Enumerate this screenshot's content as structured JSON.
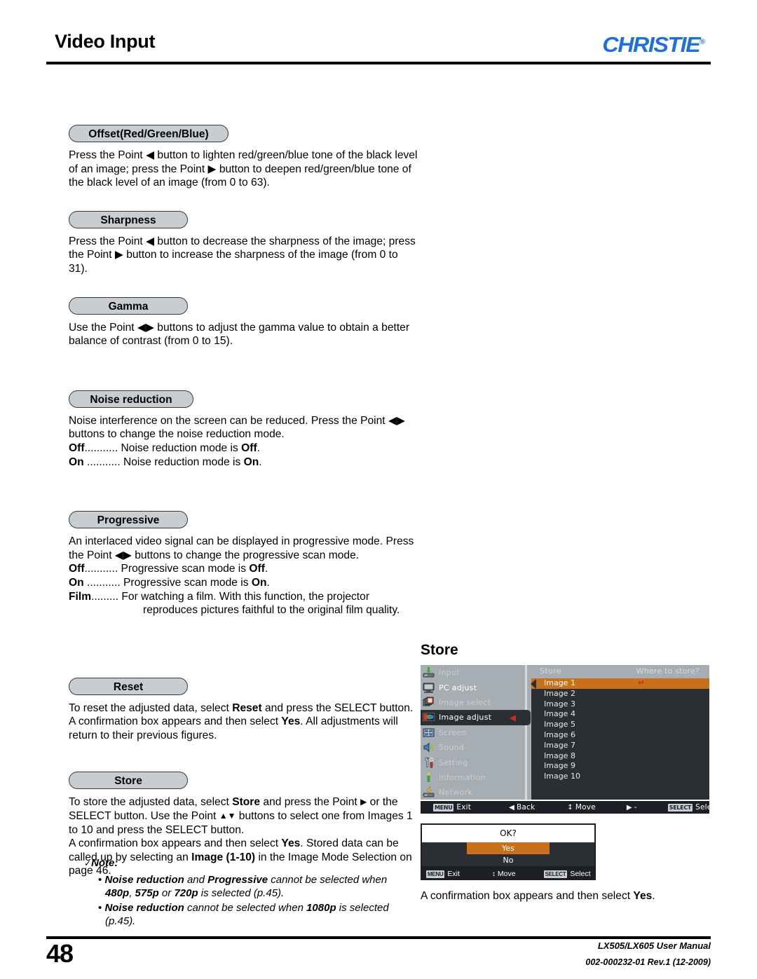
{
  "header": {
    "title": "Video Input",
    "logo_text": "CHRISTIE",
    "logo_color": "#1f6fe0",
    "registered_mark": "®"
  },
  "sections": [
    {
      "pill": "Offset(Red/Green/Blue)",
      "paragraphs": [
        "Press the Point ◀ button to lighten red/green/blue tone of the black level of an image; press the Point ▶ button to deepen red/green/blue tone of the black level of an image (from 0 to 63)."
      ],
      "definitions": []
    },
    {
      "pill": "Sharpness",
      "paragraphs": [
        "Press the Point ◀ button to decrease the sharpness of the image; press the Point ▶ button to increase the sharpness of the image (from 0 to 31)."
      ],
      "definitions": []
    },
    {
      "pill": "Gamma",
      "paragraphs": [
        "Use the Point ◀▶ buttons to adjust the gamma value to obtain a better balance of contrast (from 0 to 15)."
      ],
      "definitions": []
    },
    {
      "pill": "Noise reduction",
      "paragraphs": [
        "Noise interference on the screen can be reduced. Press the Point ◀▶ buttons to change the noise reduction mode."
      ],
      "definitions": [
        {
          "term": "Off",
          "dots": "...........",
          "desc_pre": "Noise reduction mode is ",
          "desc_bold": "Off",
          "desc_post": "."
        },
        {
          "term": "On",
          "dots": " ...........",
          "desc_pre": "Noise reduction mode is ",
          "desc_bold": "On",
          "desc_post": "."
        }
      ]
    },
    {
      "pill": "Progressive",
      "paragraphs": [
        "An interlaced video signal can be displayed in progressive mode. Press the Point ◀▶ buttons to change the progressive scan mode."
      ],
      "definitions": [
        {
          "term": "Off",
          "dots": "...........",
          "desc_pre": "Progressive scan mode is ",
          "desc_bold": "Off",
          "desc_post": "."
        },
        {
          "term": "On",
          "dots": " ...........",
          "desc_pre": "Progressive scan mode is ",
          "desc_bold": "On",
          "desc_post": "."
        },
        {
          "term": "Film",
          "dots": ".........",
          "desc_pre": "For watching a film. With this function, the projector",
          "desc_bold": "",
          "desc_post": "",
          "continuation": "reproduces pictures faithful to the original film quality."
        }
      ]
    },
    {
      "pill": "Reset",
      "paragraphs": [
        "To reset the adjusted data, select Reset and press the SELECT button. A confirmation box appears and then select Yes. All adjustments will return to their previous figures."
      ],
      "definitions": []
    },
    {
      "pill": "Store",
      "paragraphs": [
        "To store the adjusted data, select Store and press the Point ▶ or the SELECT button. Use the Point ▲▼ buttons to select one from Images 1 to 10 and press the SELECT button.",
        "A confirmation box appears and then select Yes. Stored data can be called up by selecting an Image (1-10) in the Image Mode Selection on page 46."
      ],
      "definitions": []
    }
  ],
  "note": {
    "check_glyph": "✓",
    "title": "Note:",
    "items": [
      "• Noise reduction and Progressive cannot be selected when 480p, 575p or 720p is selected (p.45).",
      "• Noise reduction cannot be selected when 1080p is selected (p.45)."
    ]
  },
  "osd": {
    "heading": "Store",
    "accent_orange": "#c9711a",
    "accent_red": "#d12a1f",
    "panel_gray": "#a7aeb3",
    "panel_dark": "#2b2f33",
    "menu_items": [
      {
        "label": "Input",
        "icon": "input-icon",
        "active": false,
        "bright": false
      },
      {
        "label": "PC adjust",
        "icon": "monitor-icon",
        "active": false,
        "bright": true
      },
      {
        "label": "Image select",
        "icon": "image-select-icon",
        "active": false,
        "bright": false
      },
      {
        "label": "Image adjust",
        "icon": "image-adjust-icon",
        "active": true,
        "bright": true
      },
      {
        "label": "Screen",
        "icon": "screen-icon",
        "active": false,
        "bright": false
      },
      {
        "label": "Sound",
        "icon": "speaker-icon",
        "active": false,
        "bright": false
      },
      {
        "label": "Setting",
        "icon": "tools-icon",
        "active": false,
        "bright": false
      },
      {
        "label": "Information",
        "icon": "info-icon",
        "active": false,
        "bright": false
      },
      {
        "label": "Network",
        "icon": "network-icon",
        "active": false,
        "bright": false
      }
    ],
    "right_panel": {
      "title": "Store",
      "prompt": "Where to store?",
      "items": [
        {
          "label": "Image 1",
          "selected": true
        },
        {
          "label": "Image 2",
          "selected": false
        },
        {
          "label": "Image 3",
          "selected": false
        },
        {
          "label": "Image 4",
          "selected": false
        },
        {
          "label": "Image 5",
          "selected": false
        },
        {
          "label": "Image 6",
          "selected": false
        },
        {
          "label": "Image 7",
          "selected": false
        },
        {
          "label": "Image 8",
          "selected": false
        },
        {
          "label": "Image 9",
          "selected": false
        },
        {
          "label": "Image 10",
          "selected": false
        }
      ],
      "enter_mark": "↵"
    },
    "footer": [
      {
        "key": "MENU",
        "glyph": "",
        "label": "Exit"
      },
      {
        "key": "",
        "glyph": "◀",
        "label": "Back"
      },
      {
        "key": "",
        "glyph": "↕",
        "label": "Move"
      },
      {
        "key": "",
        "glyph": "▶",
        "label": "-----"
      },
      {
        "key": "SELECT",
        "glyph": "",
        "label": "Select"
      }
    ]
  },
  "confirm": {
    "prompt": "OK?",
    "yes_label": "Yes",
    "no_label": "No",
    "footer": [
      {
        "key": "MENU",
        "glyph": "",
        "label": "Exit"
      },
      {
        "key": "",
        "glyph": "↕",
        "label": "Move"
      },
      {
        "key": "SELECT",
        "glyph": "",
        "label": "Select"
      }
    ],
    "caption_pre": "A confirmation box appears and then select ",
    "caption_bold": "Yes",
    "caption_post": "."
  },
  "footer": {
    "page_number": "48",
    "manual": "LX505/LX605 User Manual",
    "revision": "002-000232-01 Rev.1 (12-2009)"
  }
}
